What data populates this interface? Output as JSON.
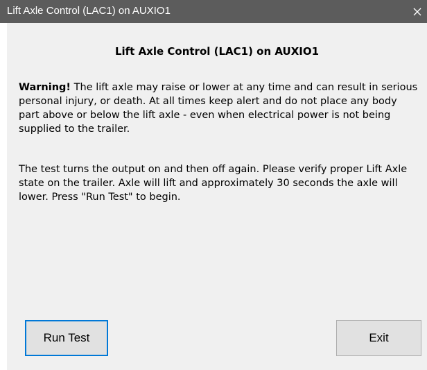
{
  "window": {
    "title": "Lift Axle Control (LAC1) on AUXIO1",
    "close_icon": "close-icon"
  },
  "dialog": {
    "heading": "Lift Axle Control (LAC1) on AUXIO1",
    "warning_label": "Warning!",
    "warning_text": " The lift axle may raise or lower at any time and can result in serious personal injury, or death. At all times keep alert and do not place any body part above or below the lift axle - even when electrical power is not being supplied to the trailer.",
    "instructions": "The test turns the output on and then off again. Please verify proper Lift Axle state on the trailer. Axle will lift and approximately 30 seconds the axle will lower. Press \"Run Test\" to begin."
  },
  "buttons": {
    "run_test": "Run Test",
    "exit": "Exit"
  },
  "colors": {
    "titlebar": "#5c5c5c",
    "dialog_background": "#f0f0f0",
    "focus_border": "#0078d7",
    "button_face": "#e1e1e1"
  }
}
